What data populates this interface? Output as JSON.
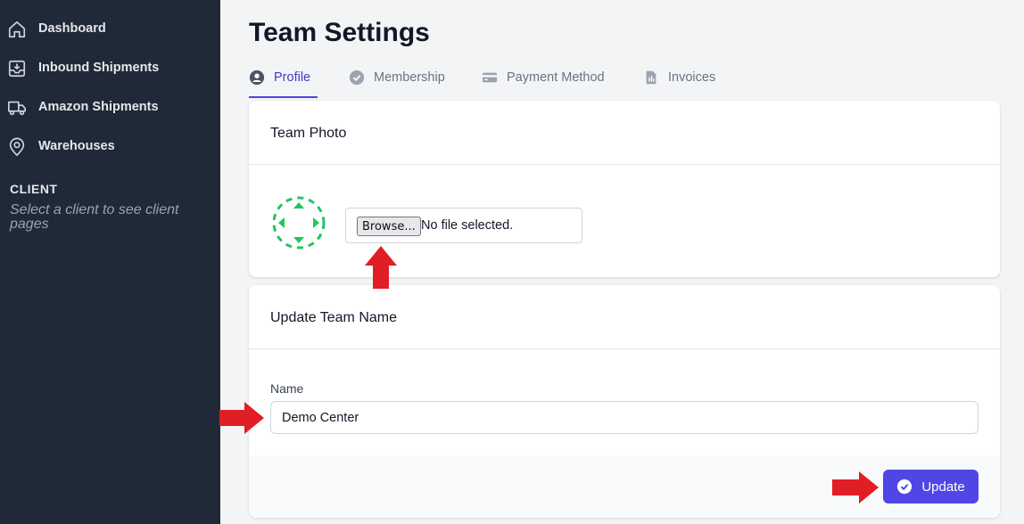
{
  "sidebar": {
    "items": [
      {
        "label": "Dashboard",
        "icon": "home-icon"
      },
      {
        "label": "Inbound Shipments",
        "icon": "inbox-download-icon"
      },
      {
        "label": "Amazon Shipments",
        "icon": "truck-icon"
      },
      {
        "label": "Warehouses",
        "icon": "map-pin-icon"
      }
    ],
    "client_heading": "CLIENT",
    "client_hint": "Select a client to see client pages"
  },
  "page": {
    "title": "Team Settings"
  },
  "tabs": [
    {
      "label": "Profile",
      "icon": "user-circle-icon",
      "active": true
    },
    {
      "label": "Membership",
      "icon": "check-circle-icon",
      "active": false
    },
    {
      "label": "Payment Method",
      "icon": "credit-card-icon",
      "active": false
    },
    {
      "label": "Invoices",
      "icon": "document-icon",
      "active": false
    }
  ],
  "team_photo": {
    "title": "Team Photo",
    "browse_label": "Browse...",
    "file_status": "No file selected.",
    "photo_icon": "expand-arrows-icon"
  },
  "team_name": {
    "title": "Update Team Name",
    "field_label": "Name",
    "field_value": "Demo Center",
    "update_label": "Update",
    "update_icon": "check-circle-icon"
  },
  "colors": {
    "sidebar_bg": "#1f2937",
    "accent": "#4f46e5",
    "photo_icon": "#22c55e",
    "annotation_arrow": "#e11d26"
  }
}
